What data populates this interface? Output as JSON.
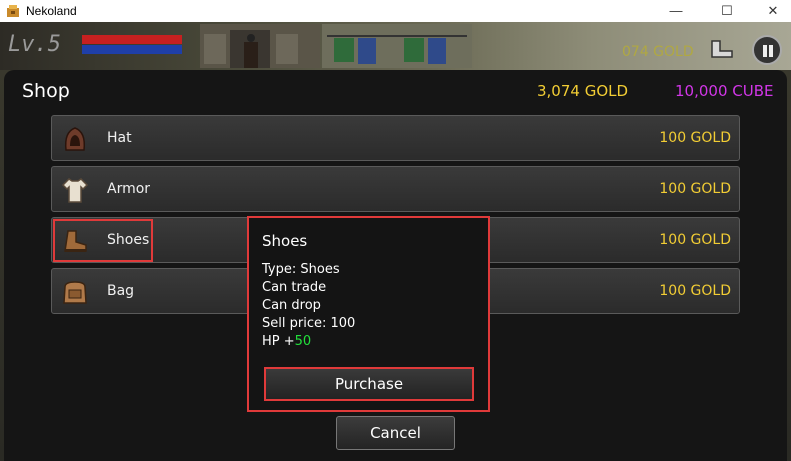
{
  "window": {
    "title": "Nekoland",
    "minimize": "—",
    "maximize": "☐",
    "close": "✕"
  },
  "hud": {
    "level": "Lv.5",
    "gold": "074 GOLD"
  },
  "shop": {
    "title": "Shop",
    "gold_total": "3,074 GOLD",
    "cube_total": "10,000 CUBE",
    "items": [
      {
        "name": "Hat",
        "price": "100 GOLD",
        "icon": "hood-icon"
      },
      {
        "name": "Armor",
        "price": "100 GOLD",
        "icon": "shirt-icon"
      },
      {
        "name": "Shoes",
        "price": "100 GOLD",
        "icon": "boot-icon"
      },
      {
        "name": "Bag",
        "price": "100 GOLD",
        "icon": "bag-icon"
      }
    ]
  },
  "tooltip": {
    "title": "Shoes",
    "type": "Type: Shoes",
    "trade": "Can trade",
    "drop": "Can drop",
    "sell": "Sell price: 100",
    "hp_label": "HP +",
    "hp_value": "50",
    "purchase_label": "Purchase"
  },
  "cancel_label": "Cancel",
  "colors": {
    "gold": "#f2cd34",
    "cube": "#d236e8",
    "highlight": "#e03a3a",
    "bonus": "#22e03c"
  }
}
